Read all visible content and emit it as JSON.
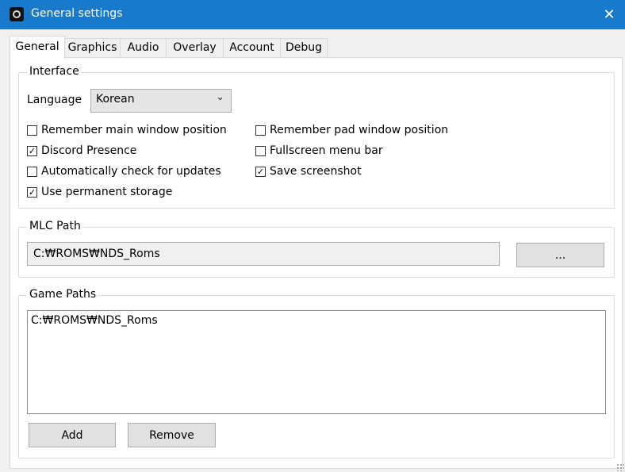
{
  "window": {
    "title": "General settings",
    "close_glyph": "✕",
    "app_icon": "gear-icon"
  },
  "tabs": [
    {
      "label": "General",
      "active": true
    },
    {
      "label": "Graphics"
    },
    {
      "label": "Audio"
    },
    {
      "label": "Overlay"
    },
    {
      "label": "Account"
    },
    {
      "label": "Debug"
    }
  ],
  "interface": {
    "group_label": "Interface",
    "language_label": "Language",
    "language_value": "Korean",
    "chevron": "⌄",
    "checkboxes": [
      {
        "label": "Remember main window position",
        "checked": false
      },
      {
        "label": "Remember pad window position",
        "checked": false
      },
      {
        "label": "Discord Presence",
        "checked": true
      },
      {
        "label": "Fullscreen menu bar",
        "checked": false
      },
      {
        "label": "Automatically check for updates",
        "checked": false
      },
      {
        "label": "Save screenshot",
        "checked": true
      },
      {
        "label": "Use permanent storage",
        "checked": true
      }
    ]
  },
  "mlc": {
    "group_label": "MLC Path",
    "value": "C:₩ROMS₩NDS_Roms",
    "browse_label": "..."
  },
  "game_paths": {
    "group_label": "Game Paths",
    "items": [
      "C:₩ROMS₩NDS_Roms"
    ],
    "add_label": "Add",
    "remove_label": "Remove"
  },
  "colors": {
    "titlebar": "#1979ca",
    "window_bg": "#f0f0f0",
    "panel_bg": "#ffffff"
  }
}
